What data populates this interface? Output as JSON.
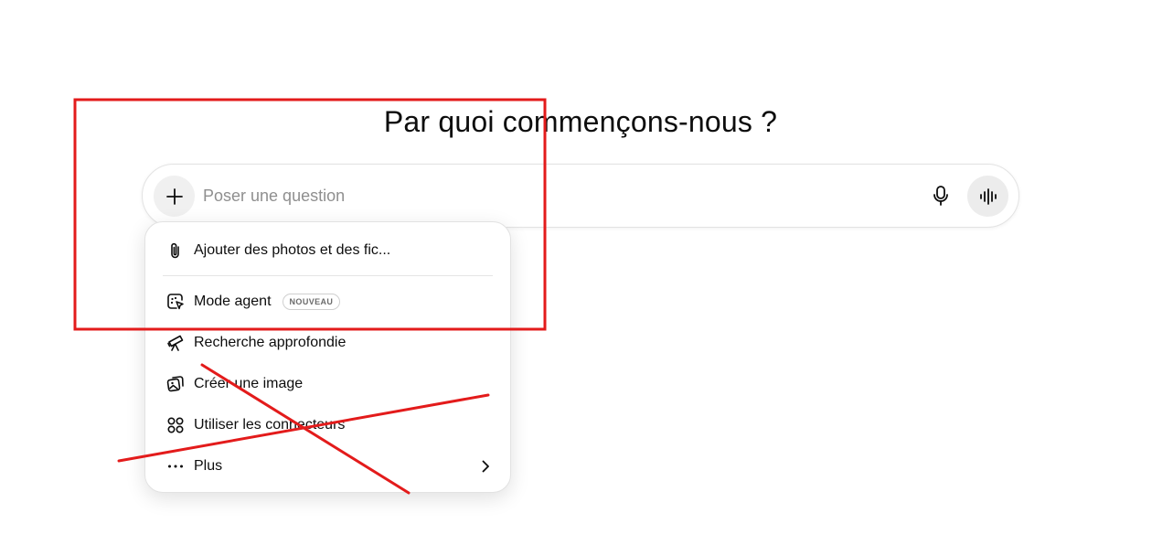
{
  "header": {
    "title": "Par quoi commençons-nous ?"
  },
  "composer": {
    "placeholder": "Poser une question",
    "add_icon": "plus-icon",
    "mic_icon": "microphone-icon",
    "voice_icon": "voice-waveform-icon"
  },
  "menu": {
    "items": [
      {
        "label": "Ajouter des photos et des fic...",
        "icon": "paperclip-icon"
      },
      {
        "label": "Mode agent",
        "icon": "agent-cursor-icon",
        "badge": "NOUVEAU"
      },
      {
        "label": "Recherche approfondie",
        "icon": "telescope-icon"
      },
      {
        "label": "Créer une image",
        "icon": "image-icon"
      },
      {
        "label": "Utiliser les connecteurs",
        "icon": "connectors-icon"
      },
      {
        "label": "Plus",
        "icon": "more-dots-icon",
        "trailing_icon": "chevron-right-icon"
      }
    ]
  },
  "annotations": {
    "color": "#e31b1b",
    "shapes": [
      "rectangle-highlight",
      "cross-out-lines"
    ]
  }
}
